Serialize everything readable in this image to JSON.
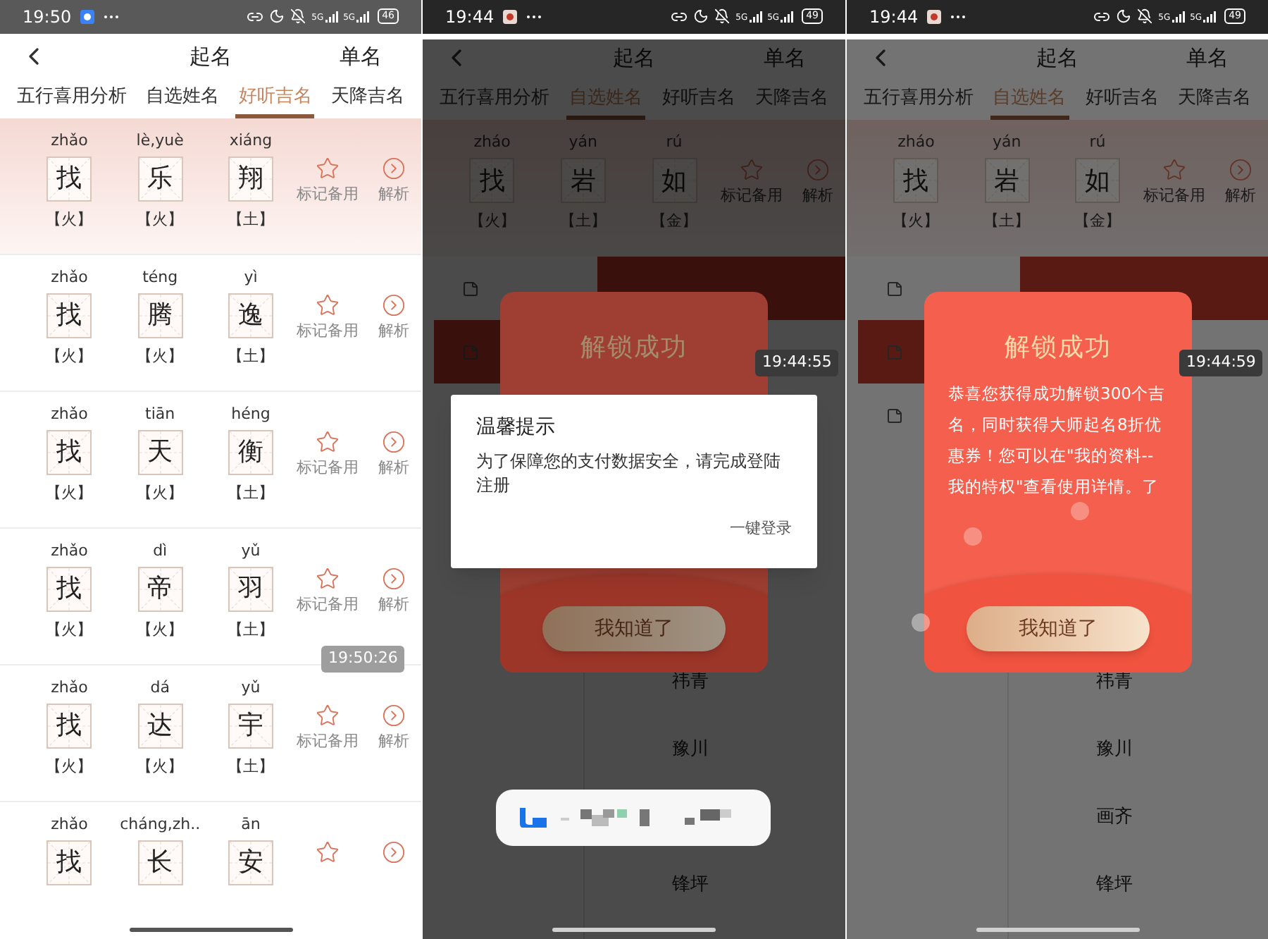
{
  "panels": [
    {
      "status_bar": {
        "time": "19:50",
        "signals": [
          "5G",
          "5G"
        ],
        "battery": "46"
      },
      "header": {
        "title": "起名",
        "action": "单名"
      },
      "tabs": [
        {
          "label": "五行喜用分析",
          "selected": false
        },
        {
          "label": "自选姓名",
          "selected": false
        },
        {
          "label": "好听吉名",
          "selected": true
        },
        {
          "label": "天降吉名",
          "selected": false
        }
      ],
      "name_rows": [
        {
          "chars": [
            {
              "pinyin": "zhǎo",
              "char": "找",
              "element": "【火】"
            },
            {
              "pinyin": "lè,yuè",
              "char": "乐",
              "element": "【火】"
            },
            {
              "pinyin": "xiáng",
              "char": "翔",
              "element": "【土】"
            }
          ],
          "mark_label": "标记备用",
          "detail_label": "解析"
        },
        {
          "chars": [
            {
              "pinyin": "zhǎo",
              "char": "找",
              "element": "【火】"
            },
            {
              "pinyin": "téng",
              "char": "腾",
              "element": "【火】"
            },
            {
              "pinyin": "yì",
              "char": "逸",
              "element": "【土】"
            }
          ],
          "mark_label": "标记备用",
          "detail_label": "解析"
        },
        {
          "chars": [
            {
              "pinyin": "zhǎo",
              "char": "找",
              "element": "【火】"
            },
            {
              "pinyin": "tiān",
              "char": "天",
              "element": "【火】"
            },
            {
              "pinyin": "héng",
              "char": "衡",
              "element": "【土】"
            }
          ],
          "mark_label": "标记备用",
          "detail_label": "解析"
        },
        {
          "chars": [
            {
              "pinyin": "zhǎo",
              "char": "找",
              "element": "【火】"
            },
            {
              "pinyin": "dì",
              "char": "帝",
              "element": "【火】"
            },
            {
              "pinyin": "yǔ",
              "char": "羽",
              "element": "【土】"
            }
          ],
          "mark_label": "标记备用",
          "detail_label": "解析"
        },
        {
          "chars": [
            {
              "pinyin": "zhǎo",
              "char": "找",
              "element": "【火】"
            },
            {
              "pinyin": "dá",
              "char": "达",
              "element": "【火】"
            },
            {
              "pinyin": "yǔ",
              "char": "宇",
              "element": "【土】"
            }
          ],
          "mark_label": "标记备用",
          "detail_label": "解析"
        },
        {
          "chars": [
            {
              "pinyin": "zhǎo",
              "char": "找"
            },
            {
              "pinyin": "cháng,zh..",
              "char": "长"
            },
            {
              "pinyin": "ān",
              "char": "安"
            }
          ]
        }
      ],
      "timestamp": "19:50:26"
    },
    {
      "dimmed": true,
      "status_bar": {
        "time": "19:44",
        "signals": [
          "5G",
          "5G"
        ],
        "battery": "49"
      },
      "header": {
        "title": "起名",
        "action": "单名"
      },
      "tabs": [
        {
          "label": "五行喜用分析",
          "selected": false
        },
        {
          "label": "自选姓名",
          "selected": true
        },
        {
          "label": "好听吉名",
          "selected": false
        },
        {
          "label": "天降吉名",
          "selected": false
        }
      ],
      "name_rows": [
        {
          "chars": [
            {
              "pinyin": "zháo",
              "char": "找",
              "element": "【火】"
            },
            {
              "pinyin": "yán",
              "char": "岩",
              "element": "【土】"
            },
            {
              "pinyin": "rú",
              "char": "如",
              "element": "【金】"
            }
          ],
          "mark_label": "标记备用",
          "detail_label": "解析"
        }
      ],
      "names": [
        {
          "kind": "name",
          "text": "祎青"
        },
        {
          "kind": "name",
          "text": "豫川"
        },
        {
          "kind": "blank"
        },
        {
          "kind": "name",
          "text": "锋坪"
        }
      ],
      "card": {
        "title": "解锁成功",
        "button": "我知道了"
      },
      "dialog": {
        "title": "温馨提示",
        "body": "为了保障您的支付数据安全，请完成登陆注册",
        "action": "一键登录"
      },
      "toast": true,
      "timestamp": "19:44:55"
    },
    {
      "dimmed": true,
      "status_bar": {
        "time": "19:44",
        "signals": [
          "5G",
          "5G"
        ],
        "battery": "49"
      },
      "header": {
        "title": "起名",
        "action": "单名"
      },
      "tabs": [
        {
          "label": "五行喜用分析",
          "selected": false
        },
        {
          "label": "自选姓名",
          "selected": true
        },
        {
          "label": "好听吉名",
          "selected": false
        },
        {
          "label": "天降吉名",
          "selected": false
        }
      ],
      "name_rows": [
        {
          "chars": [
            {
              "pinyin": "zháo",
              "char": "找",
              "element": "【火】"
            },
            {
              "pinyin": "yán",
              "char": "岩",
              "element": "【土】"
            },
            {
              "pinyin": "rú",
              "char": "如",
              "element": "【金】"
            }
          ],
          "mark_label": "标记备用",
          "detail_label": "解析"
        }
      ],
      "names": [
        {
          "kind": "name",
          "text": "祎青"
        },
        {
          "kind": "name",
          "text": "豫川"
        },
        {
          "kind": "name",
          "text": "画齐"
        },
        {
          "kind": "name",
          "text": "锋坪"
        }
      ],
      "card": {
        "title": "解锁成功",
        "body": "恭喜您获得成功解锁300个吉名，同时获得大师起名8折优惠券！您可以在\"我的资料--我的特权\"查看使用详情。了",
        "button": "我知道了"
      },
      "touch_marks": true,
      "timestamp": "19:44:59"
    }
  ]
}
